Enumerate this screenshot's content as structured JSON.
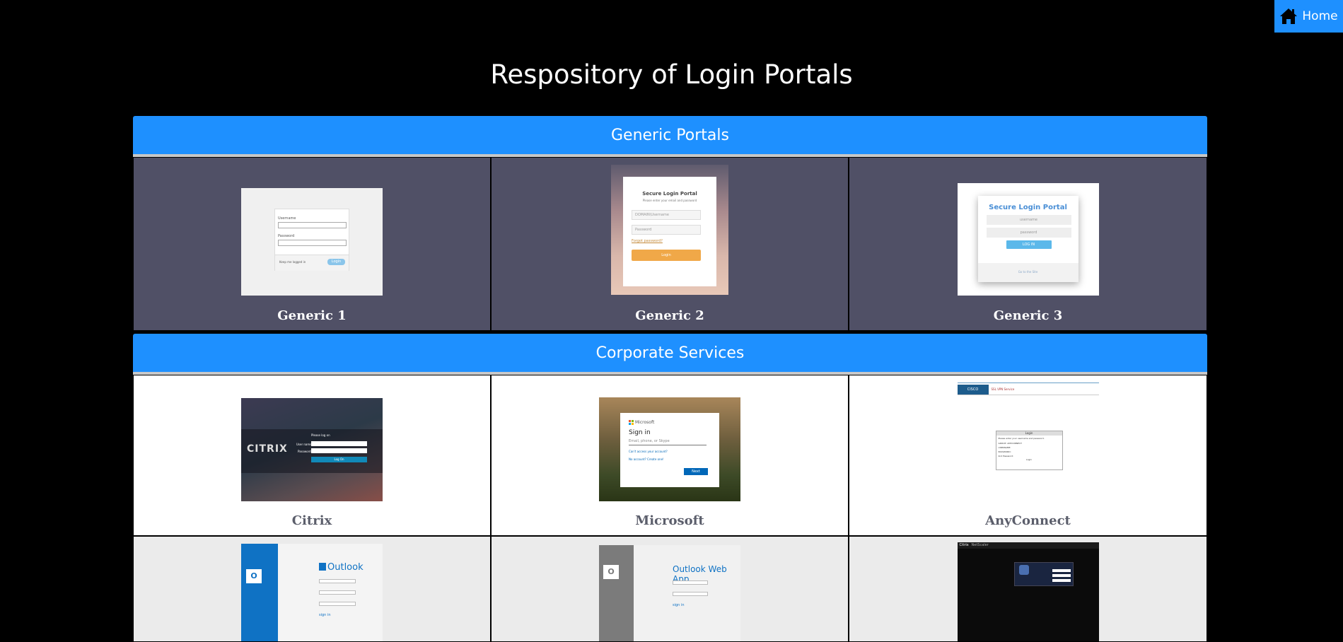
{
  "nav": {
    "home_label": "Home"
  },
  "page": {
    "title": "Respository of Login Portals"
  },
  "sections": [
    {
      "title": "Generic Portals",
      "tiles": [
        {
          "label": "Generic 1"
        },
        {
          "label": "Generic 2"
        },
        {
          "label": "Generic 3"
        }
      ]
    },
    {
      "title": "Corporate Services",
      "tiles": [
        {
          "label": "Citrix"
        },
        {
          "label": "Microsoft"
        },
        {
          "label": "AnyConnect"
        },
        {
          "label": ""
        },
        {
          "label": ""
        },
        {
          "label": ""
        }
      ]
    }
  ],
  "thumbnails": {
    "generic1": {
      "username": "Username",
      "password": "Password",
      "remember": "Keep me logged in",
      "button": "Login"
    },
    "generic2": {
      "title": "Secure Login Portal",
      "subtitle": "Please enter your email and password",
      "user_placeholder": "DOMAIN\\Username",
      "pass_placeholder": "Password",
      "forgot": "Forgot password?",
      "button": "Login"
    },
    "generic3": {
      "title": "Secure Login Portal",
      "user_placeholder": "username",
      "pass_placeholder": "password",
      "button": "LOG IN",
      "footer": "Go to the Site"
    },
    "citrix": {
      "logo": "CITRIX",
      "heading": "Please log on",
      "user": "User name:",
      "pass": "Password:",
      "button": "Log On"
    },
    "microsoft": {
      "brand": "Microsoft",
      "heading": "Sign in",
      "placeholder": "Email, phone, or Skype",
      "cant_access": "Can't access your account?",
      "no_account": "No account? Create one!",
      "button": "Next"
    },
    "anyconnect": {
      "brand": "CISCO",
      "banner": "SSL VPN Service",
      "heading": "Login",
      "prompt": "Please enter your username and password.",
      "group": "GROUP:",
      "group_value": "ANYCONNECT",
      "user": "USERNAME:",
      "pass": "PASSWORD:",
      "second": "2nd Password:",
      "button": "Login"
    },
    "outlook": {
      "brand": "Outlook",
      "signin": "sign in"
    },
    "owa": {
      "brand": "Outlook Web App",
      "signin": "sign in"
    },
    "netscaler": {
      "brand": "Citrix",
      "product": "NetScaler"
    }
  },
  "colors": {
    "accent": "#1e90ff",
    "tile_dark": "#505066",
    "label_grey": "#5b5e6b"
  },
  "icons": {
    "home": "home-icon"
  }
}
